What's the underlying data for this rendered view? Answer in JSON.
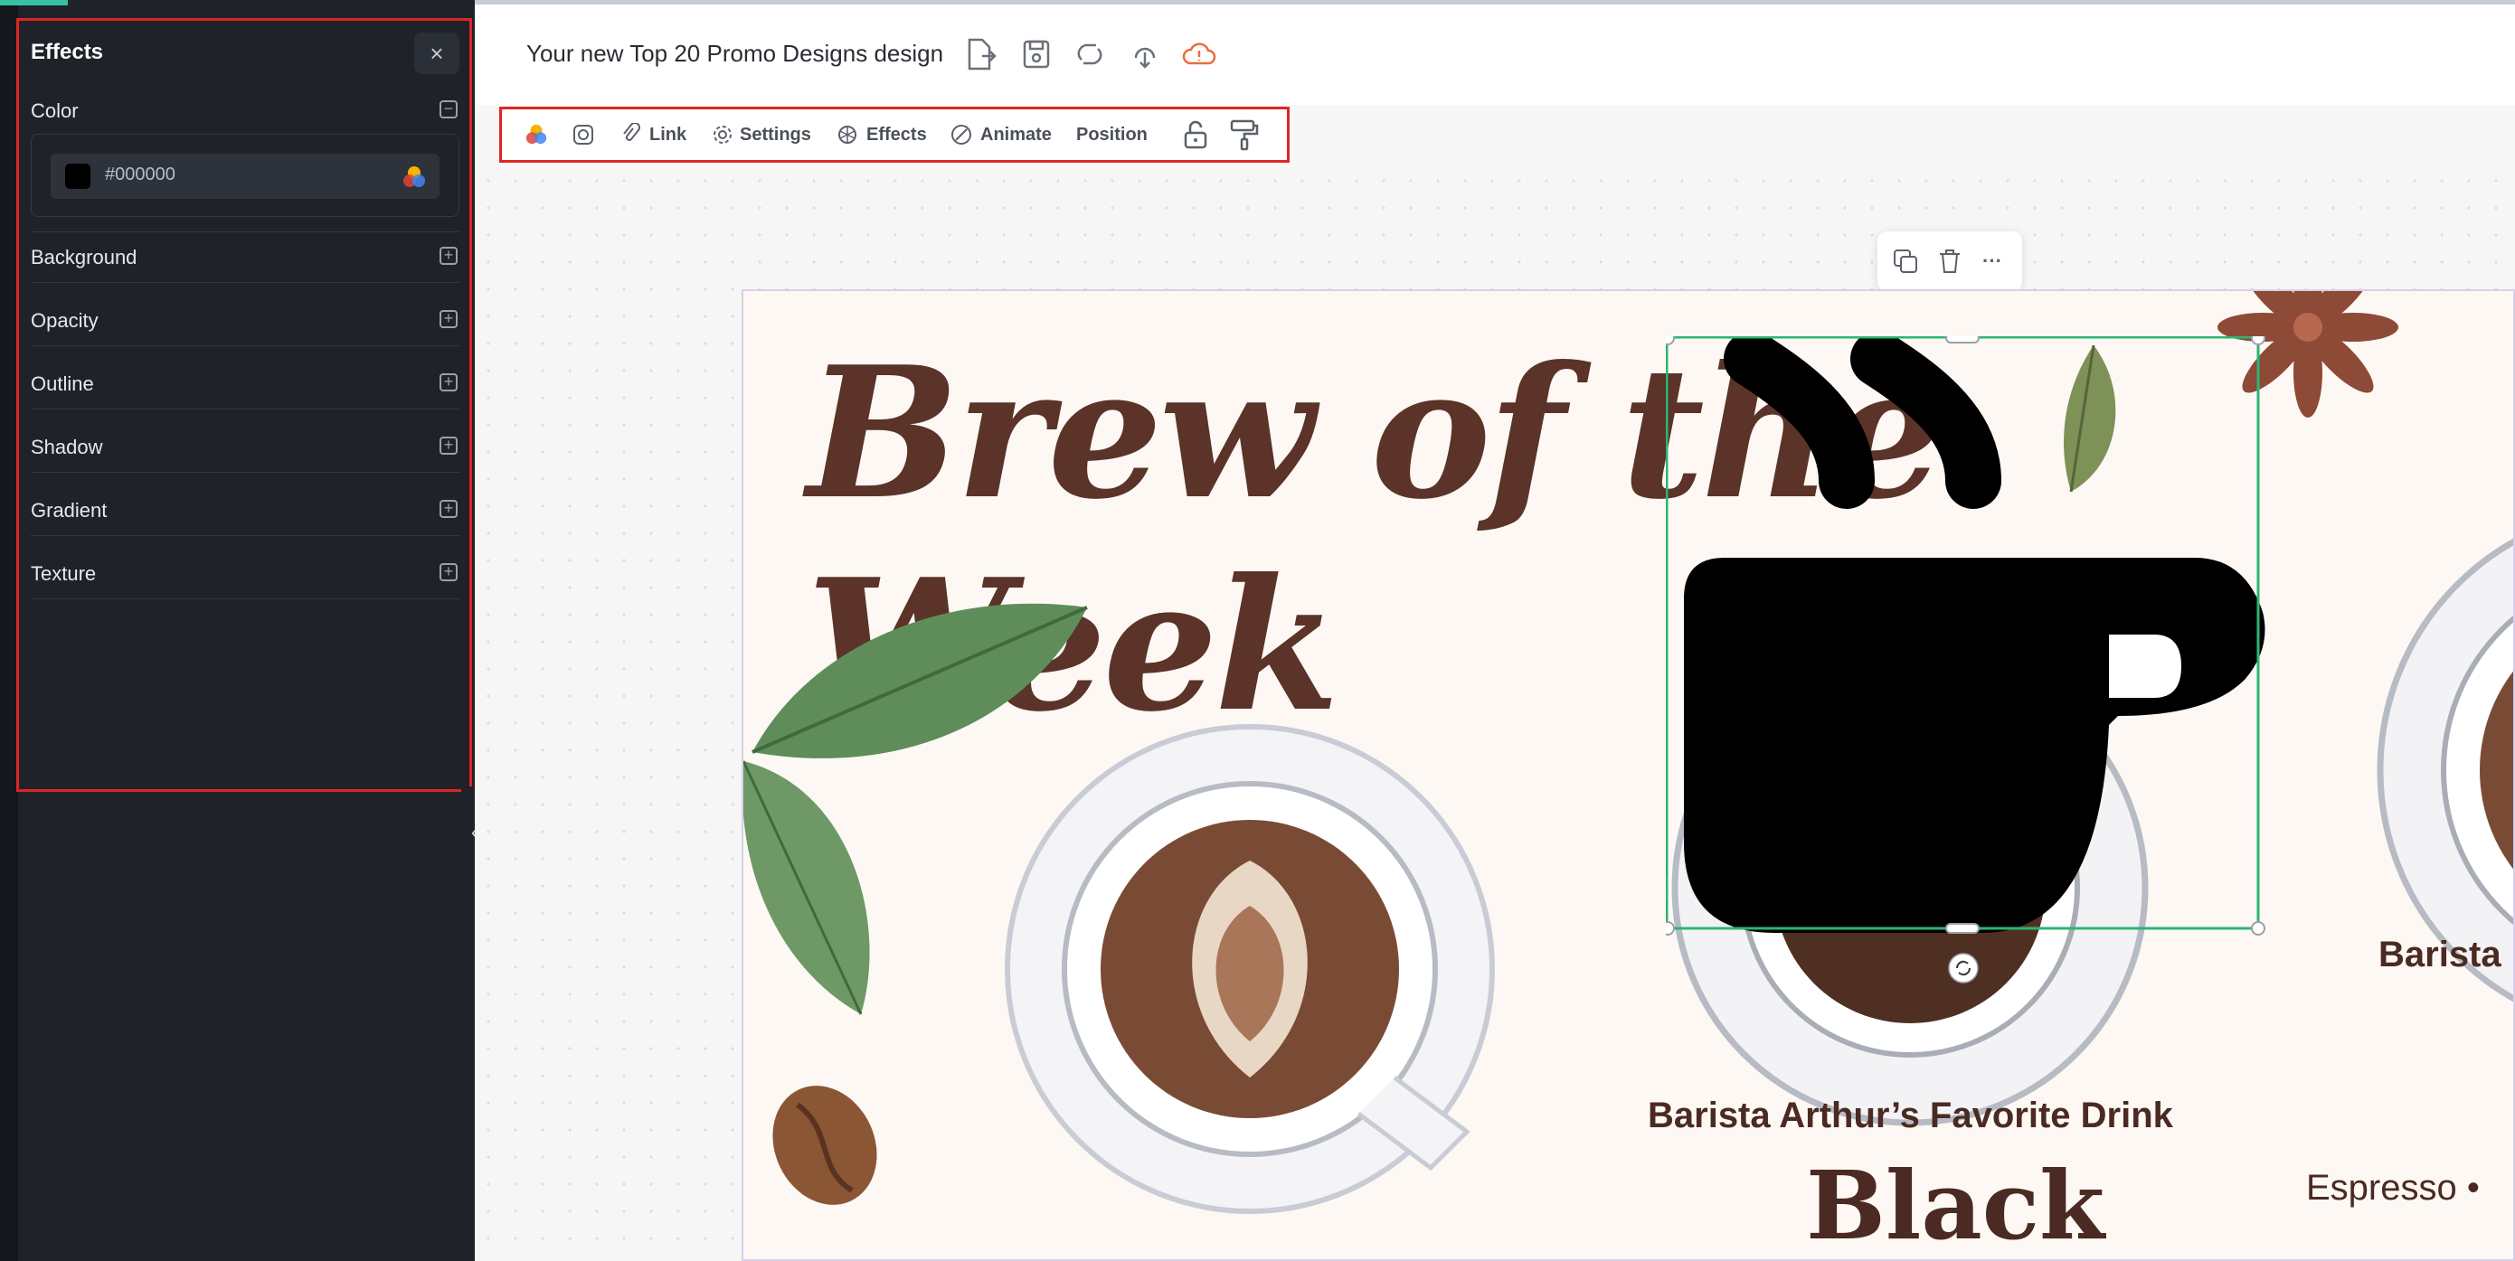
{
  "sidebar": {
    "panel_title": "Effects",
    "close_label": "×",
    "collapse_label": "‹",
    "color": {
      "label": "Color",
      "hex": "#000000",
      "swatch": "#000000"
    },
    "sections": [
      {
        "label": "Background"
      },
      {
        "label": "Opacity"
      },
      {
        "label": "Outline"
      },
      {
        "label": "Shadow"
      },
      {
        "label": "Gradient"
      },
      {
        "label": "Texture"
      }
    ]
  },
  "header": {
    "doc_title": "Your new Top 20 Promo Designs design",
    "icons": [
      "export-icon",
      "save-icon",
      "sync-icon",
      "download-icon",
      "cloud-warning-icon"
    ]
  },
  "toolbar": {
    "link": "Link",
    "settings": "Settings",
    "effects": "Effects",
    "animate": "Animate",
    "position": "Position"
  },
  "floating_toolbar": {
    "more": "···"
  },
  "artboard": {
    "headline": "Brew of the Week",
    "subtitle_main": "Barista Arthur’s Favorite Drink",
    "drink_name": "Black",
    "subtitle_right": "Barista",
    "espresso_line": "Espresso •"
  },
  "colors": {
    "accent_red": "#e02424",
    "selection_green": "#2bb673",
    "brand_teal": "#36c2a2",
    "headline_brown": "#5b3328",
    "warning_orange": "#ef6a3a"
  }
}
